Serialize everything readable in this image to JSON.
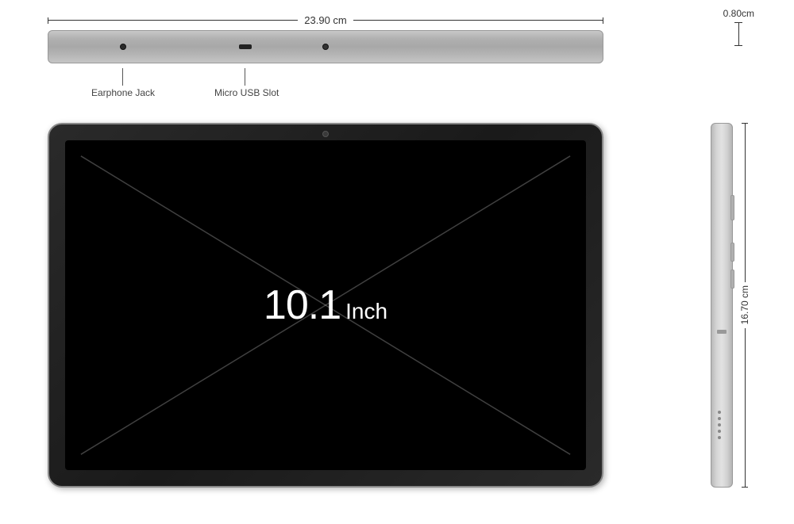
{
  "dimensions": {
    "width_label": "23.90 cm",
    "height_label": "16.70 cm",
    "thickness_label": "0.80cm"
  },
  "labels": {
    "earphone_jack": "Earphone Jack",
    "micro_usb": "Micro USB Slot",
    "screen_size": "10.1",
    "screen_unit": "Inch"
  },
  "icons": {
    "camera": "camera-icon",
    "earphone": "earphone-icon",
    "usb": "usb-icon"
  }
}
